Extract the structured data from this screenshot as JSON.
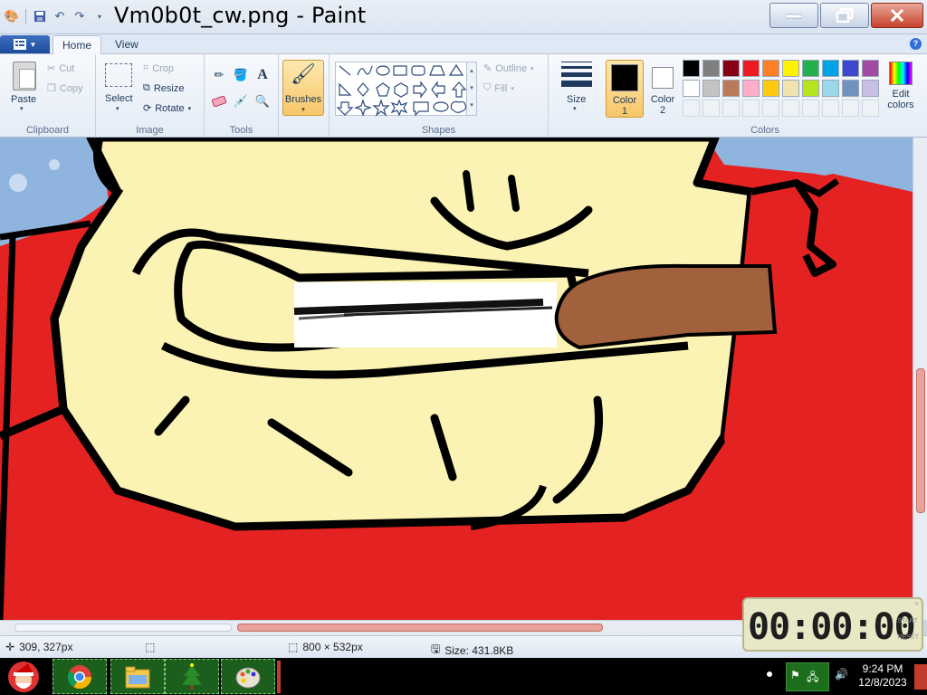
{
  "window": {
    "title": "Vm0b0t_cw.png - Paint"
  },
  "ribbon_tabs": [
    {
      "label": "Home"
    },
    {
      "label": "View"
    }
  ],
  "clipboard": {
    "paste": "Paste",
    "cut": "Cut",
    "copy": "Copy",
    "group": "Clipboard"
  },
  "image": {
    "select": "Select",
    "crop": "Crop",
    "resize": "Resize",
    "rotate": "Rotate",
    "group": "Image"
  },
  "tools": {
    "group": "Tools"
  },
  "brushes": {
    "label": "Brushes"
  },
  "shapes": {
    "outline": "Outline",
    "fill": "Fill",
    "group": "Shapes"
  },
  "size": {
    "label": "Size"
  },
  "colors": {
    "color1_label": "Color",
    "color1_num": "1",
    "color2_label": "Color",
    "color2_num": "2",
    "edit_label": "Edit",
    "edit_label2": "colors",
    "group": "Colors",
    "color1": "#000000",
    "color2": "#ffffff",
    "palette_row1": [
      "#000000",
      "#7f7f7f",
      "#880015",
      "#ed1c24",
      "#ff7f27",
      "#fff200",
      "#22b14c",
      "#00a2e8",
      "#3f48cc",
      "#a349a4"
    ],
    "palette_row2": [
      "#ffffff",
      "#c3c3c3",
      "#b97a57",
      "#ffaec9",
      "#ffc90e",
      "#efe4b0",
      "#b5e61d",
      "#99d9ea",
      "#7092be",
      "#c8bfe7"
    ]
  },
  "statusbar": {
    "cursor_pos": "309, 327px",
    "image_size": "800 × 532px",
    "file_size": "Size: 431.8KB"
  },
  "timer": {
    "value": "00:00:00",
    "side1": "START",
    "side2": "RESET"
  },
  "taskbar": {
    "time": "9:24 PM",
    "date": "12/8/2023"
  }
}
